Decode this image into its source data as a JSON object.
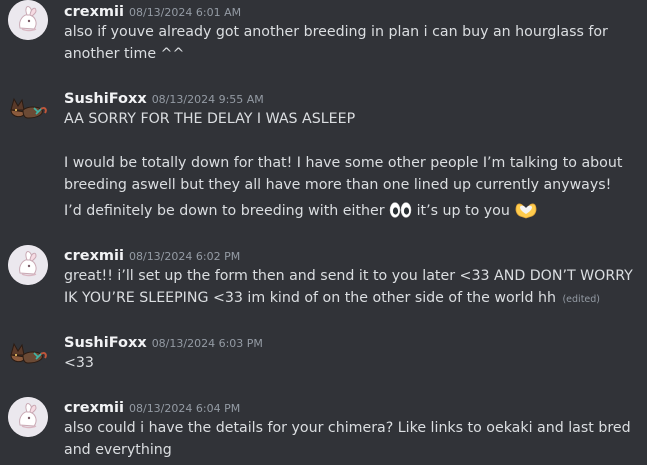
{
  "messages": [
    {
      "username": "crexmii",
      "timestamp": "08/13/2024 6:01 AM",
      "lines": [
        "also if youve already got another breeding in plan i can buy an hourglass for another time ^^"
      ]
    },
    {
      "username": "SushiFoxx",
      "timestamp": "08/13/2024 9:55 AM",
      "lines": [
        "AA SORRY FOR THE DELAY I WAS ASLEEP",
        "I would be totally down for that! I have some other people I’m talking to about breeding aswell but they all have more than one lined up currently anyways!",
        "I’d definitely be down to breeding with either",
        "it’s up to you"
      ],
      "emojis": [
        "eyes-emoji",
        "heart-hands-emoji"
      ]
    },
    {
      "username": "crexmii",
      "timestamp": "08/13/2024 6:02 PM",
      "lines": [
        "great!! i’ll set up the form then and send it to you later <33 AND DON’T WORRY IK YOU’RE SLEEPING <33 im kind of on the other side of the world hh"
      ],
      "edited": "(edited)"
    },
    {
      "username": "SushiFoxx",
      "timestamp": "08/13/2024 6:03 PM",
      "lines": [
        "<33"
      ]
    },
    {
      "username": "crexmii",
      "timestamp": "08/13/2024 6:04 PM",
      "lines": [
        "also could i have the details for your chimera? Like links to oekaki and last bred and everything"
      ]
    }
  ],
  "colors": {
    "background": "#313338",
    "username": "#f2f3f5",
    "text": "#dbdee1",
    "timestamp": "#949ba4"
  }
}
